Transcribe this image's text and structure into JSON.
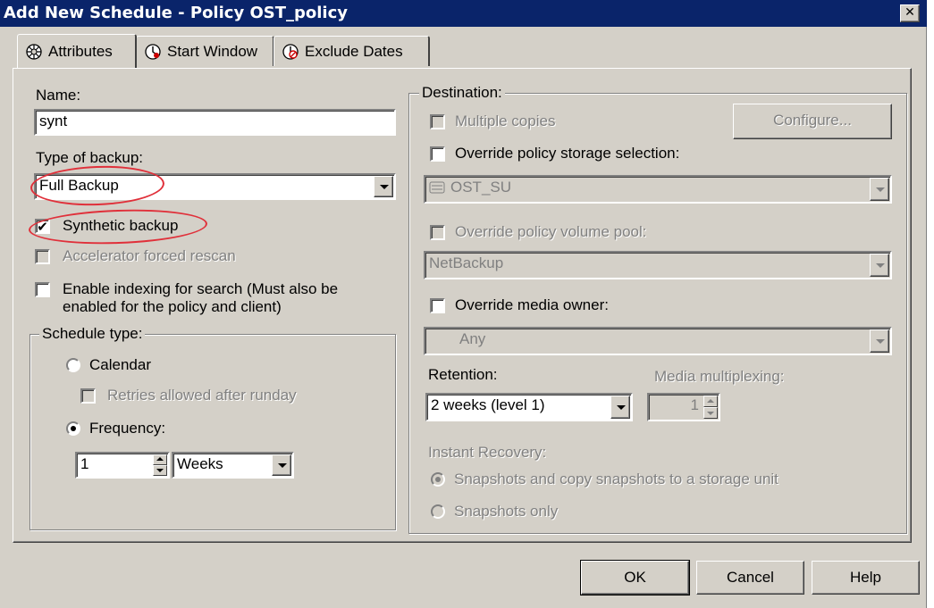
{
  "window": {
    "title": "Add New Schedule - Policy OST_policy",
    "close_glyph": "✕"
  },
  "tabs": [
    {
      "label": "Attributes",
      "icon": "attributes-icon",
      "active": true
    },
    {
      "label": "Start Window",
      "icon": "clock-icon",
      "active": false
    },
    {
      "label": "Exclude Dates",
      "icon": "exclude-dates-icon",
      "active": false
    }
  ],
  "left": {
    "name_label": "Name:",
    "name_value": "synt",
    "type_label": "Type of backup:",
    "type_value": "Full Backup",
    "synthetic": {
      "label": "Synthetic backup",
      "checked": true,
      "mark": "✔"
    },
    "accelerator": {
      "label": "Accelerator forced rescan",
      "checked": false
    },
    "indexing": {
      "label_line1": "Enable indexing for search (Must also be",
      "label_line2": "enabled for the policy and client)",
      "checked": false
    },
    "schedule_type": {
      "title": "Schedule type:",
      "calendar": "Calendar",
      "retries": "Retries allowed after runday",
      "frequency": "Frequency:",
      "frequency_value": "1",
      "frequency_unit": "Weeks"
    }
  },
  "right": {
    "destination_title": "Destination:",
    "multiple_copies": "Multiple copies",
    "configure_button": "Configure...",
    "override_storage": "Override policy storage selection:",
    "storage_value": "OST_SU",
    "override_pool": "Override policy volume pool:",
    "pool_value": "NetBackup",
    "override_owner": "Override media owner:",
    "owner_value": "Any",
    "retention_label": "Retention:",
    "retention_value": "2 weeks (level 1)",
    "multiplexing_label": "Media multiplexing:",
    "multiplexing_value": "1",
    "instant_recovery_label": "Instant Recovery:",
    "ir_option1": "Snapshots and copy snapshots to a storage unit",
    "ir_option2": "Snapshots only"
  },
  "footer": {
    "ok": "OK",
    "cancel": "Cancel",
    "help": "Help"
  },
  "annotation_color": "#e0303a"
}
